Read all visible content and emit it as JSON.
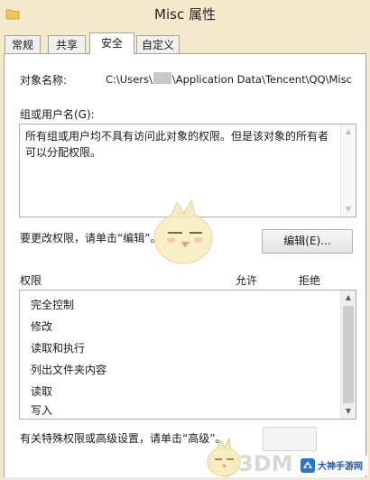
{
  "window": {
    "title": "Misc 属性"
  },
  "tabs": [
    {
      "label": "常规",
      "active": false
    },
    {
      "label": "共享",
      "active": false
    },
    {
      "label": "安全",
      "active": true
    },
    {
      "label": "自定义",
      "active": false
    }
  ],
  "security": {
    "object_name_label": "对象名称:",
    "object_path_prefix": "C:\\Users\\",
    "object_path_suffix": "\\Application Data\\Tencent\\QQ\\Misc",
    "group_label": "组或用户名(G):",
    "group_message": "所有组或用户均不具有访问此对象的权限。但是该对象的所有者可以分配权限。",
    "change_permissions_text": "要更改权限，请单击“编辑”。",
    "edit_button": "编辑(E)...",
    "permissions_label": "权限",
    "allow_header": "允许",
    "deny_header": "拒绝",
    "permissions": [
      "完全控制",
      "修改",
      "读取和执行",
      "列出文件夹内容",
      "读取",
      "写入"
    ],
    "advanced_text": "有关特殊权限或高级设置，请单击“高级”。"
  },
  "watermark": {
    "text": "3DM",
    "site_name": "大神手游网"
  },
  "colors": {
    "window_frame": "#f3e9cc",
    "panel_bg": "#ffffff",
    "border": "#adadad"
  },
  "icons": [
    "folder-icon",
    "scroll-up-icon",
    "scroll-down-icon",
    "mascot-bird-icon",
    "site-logo-icon"
  ]
}
